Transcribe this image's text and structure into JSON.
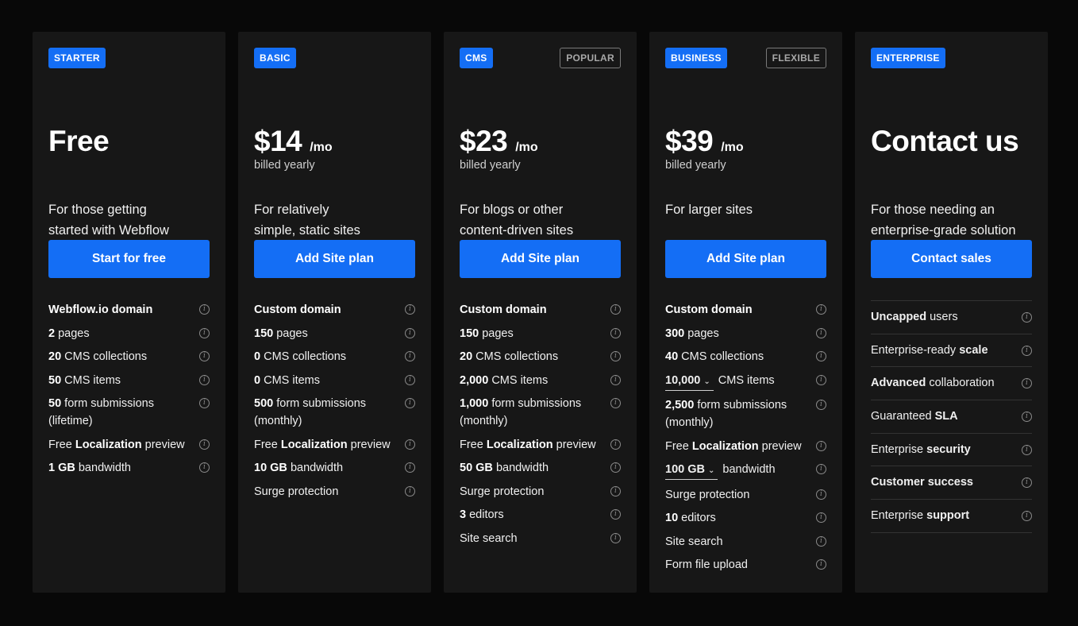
{
  "plans": [
    {
      "tag": "STARTER",
      "badge": "",
      "price": "Free",
      "per": "",
      "billed": "",
      "desc": [
        "For those getting",
        "started with Webflow"
      ],
      "cta": "Start for free",
      "features": [
        {
          "bold": "Webflow.io domain",
          "text": ""
        },
        {
          "bold": "2",
          "text": " pages"
        },
        {
          "bold": "20",
          "text": " CMS collections"
        },
        {
          "bold": "50",
          "text": " CMS items"
        },
        {
          "bold": "50",
          "text": " form submissions (lifetime)"
        },
        {
          "pre": "Free ",
          "bold": "Localization",
          "text": " preview"
        },
        {
          "bold": "1 GB",
          "text": " bandwidth"
        }
      ]
    },
    {
      "tag": "BASIC",
      "badge": "",
      "price": "$14",
      "per": "/mo",
      "billed": "billed yearly",
      "desc": [
        "For relatively",
        "simple, static sites"
      ],
      "cta": "Add Site plan",
      "features": [
        {
          "bold": "Custom domain",
          "text": ""
        },
        {
          "bold": "150",
          "text": " pages"
        },
        {
          "bold": "0",
          "text": " CMS collections"
        },
        {
          "bold": "0",
          "text": " CMS items"
        },
        {
          "bold": "500",
          "text": " form submissions (monthly)"
        },
        {
          "pre": "Free ",
          "bold": "Localization",
          "text": " preview"
        },
        {
          "bold": "10 GB",
          "text": " bandwidth"
        },
        {
          "bold": "",
          "text": "Surge protection"
        }
      ]
    },
    {
      "tag": "CMS",
      "badge": "POPULAR",
      "price": "$23",
      "per": "/mo",
      "billed": "billed yearly",
      "desc": [
        "For blogs or other",
        "content-driven sites"
      ],
      "cta": "Add Site plan",
      "features": [
        {
          "bold": "Custom domain",
          "text": ""
        },
        {
          "bold": "150",
          "text": " pages"
        },
        {
          "bold": "20",
          "text": " CMS collections"
        },
        {
          "bold": "2,000",
          "text": " CMS items"
        },
        {
          "bold": "1,000",
          "text": " form submissions (monthly)"
        },
        {
          "pre": "Free ",
          "bold": "Localization",
          "text": " preview"
        },
        {
          "bold": "50 GB",
          "text": " bandwidth"
        },
        {
          "bold": "",
          "text": "Surge protection"
        },
        {
          "bold": "3",
          "text": " editors"
        },
        {
          "bold": "",
          "text": "Site search"
        }
      ]
    },
    {
      "tag": "BUSINESS",
      "badge": "FLEXIBLE",
      "price": "$39",
      "per": "/mo",
      "billed": "billed yearly",
      "desc": [
        "For larger sites",
        ""
      ],
      "cta": "Add Site plan",
      "features": [
        {
          "bold": "Custom domain",
          "text": ""
        },
        {
          "bold": "300",
          "text": " pages"
        },
        {
          "bold": "40",
          "text": " CMS collections"
        },
        {
          "select": "10,000",
          "text": " CMS items"
        },
        {
          "bold": "2,500",
          "text": " form submissions (monthly)"
        },
        {
          "pre": "Free ",
          "bold": "Localization",
          "text": " preview"
        },
        {
          "select": "100 GB",
          "text": " bandwidth"
        },
        {
          "bold": "",
          "text": "Surge protection"
        },
        {
          "bold": "10",
          "text": " editors"
        },
        {
          "bold": "",
          "text": "Site search"
        },
        {
          "bold": "",
          "text": "Form file upload"
        }
      ]
    }
  ],
  "enterprise": {
    "tag": "ENTERPRISE",
    "price": "Contact us",
    "desc": [
      "For those needing an",
      "enterprise-grade solution"
    ],
    "cta": "Contact sales",
    "features": [
      {
        "pre": "",
        "bold": "Uncapped",
        "text": " users"
      },
      {
        "pre": "Enterprise-ready ",
        "bold": "scale",
        "text": ""
      },
      {
        "pre": "",
        "bold": "Advanced",
        "text": " collaboration"
      },
      {
        "pre": "Guaranteed ",
        "bold": "SLA",
        "text": ""
      },
      {
        "pre": "Enterprise ",
        "bold": "security",
        "text": ""
      },
      {
        "pre": "",
        "bold": "Customer success",
        "text": ""
      },
      {
        "pre": "Enterprise ",
        "bold": "support",
        "text": ""
      }
    ]
  },
  "icons": {
    "info": "info-icon",
    "chevron": "chevron-down-icon"
  },
  "colors": {
    "accent": "#146ef5",
    "card": "#171717",
    "background": "#080808"
  }
}
